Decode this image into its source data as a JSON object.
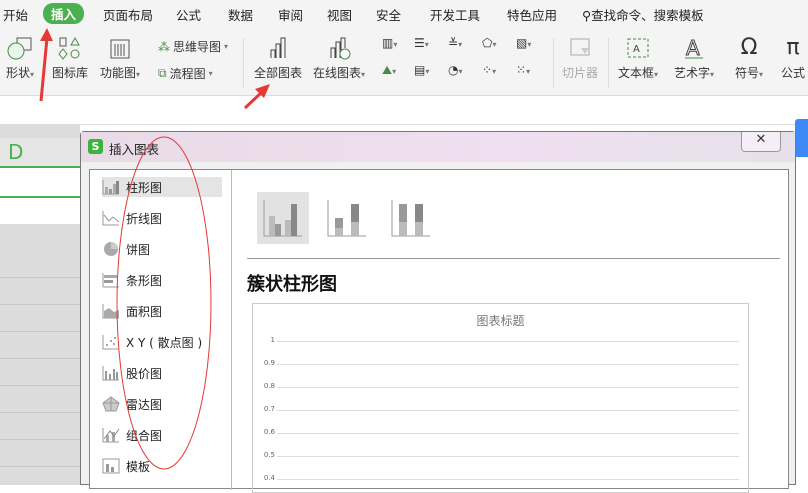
{
  "menu": {
    "items": [
      "开始",
      "插入",
      "页面布局",
      "公式",
      "数据",
      "审阅",
      "视图",
      "安全",
      "开发工具",
      "特色应用"
    ],
    "active": "插入",
    "search": "查找命令、搜索模板"
  },
  "ribbon": {
    "shape": "形状",
    "icon_lib": "图标库",
    "function_chart": "功能图",
    "mind_map": "思维导图",
    "flowchart": "流程图",
    "all_charts": "全部图表",
    "online_charts": "在线图表",
    "slicer": "切片器",
    "textbox": "文本框",
    "wordart": "艺术字",
    "symbol": "符号",
    "formula": "公式"
  },
  "sheet": {
    "column": "D"
  },
  "dialog": {
    "title": "插入图表",
    "close_label": "✕",
    "categories": [
      "柱形图",
      "折线图",
      "饼图",
      "条形图",
      "面积图",
      "X Y ( 散点图 )",
      "股价图",
      "雷达图",
      "组合图",
      "模板"
    ],
    "selected_category": "柱形图",
    "subtype_title": "簇状柱形图",
    "preview": {
      "title": "图表标题",
      "y_ticks": [
        "1",
        "0.9",
        "0.8",
        "0.7",
        "0.6",
        "0.5",
        "0.4"
      ]
    }
  },
  "colors": {
    "accent": "#4caf50",
    "annotation": "#e53935"
  }
}
